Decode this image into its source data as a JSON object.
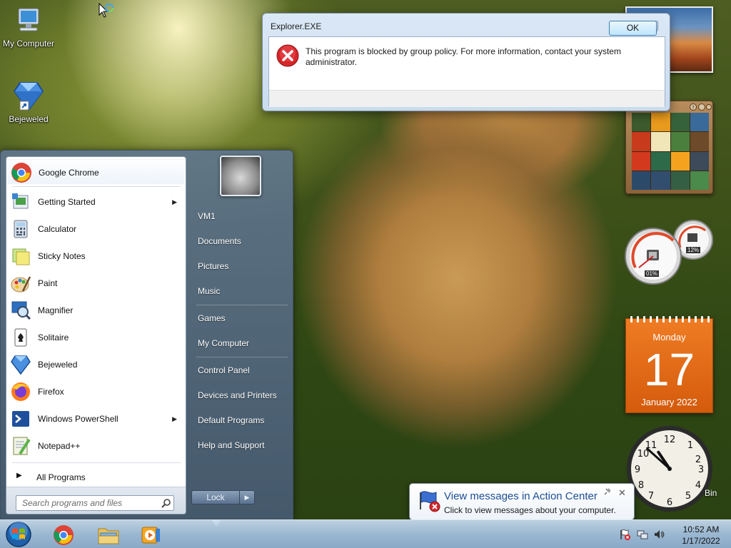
{
  "desktop": {
    "icons": [
      {
        "label": "My Computer",
        "icon": "computer-icon"
      },
      {
        "label": "Bejeweled",
        "icon": "bejeweled-icon"
      }
    ],
    "recycle_bin_partial": "Bin"
  },
  "dialog": {
    "title": "Explorer.EXE",
    "close_glyph": "✕",
    "message": "This program is blocked by group policy. For more information, contact your system administrator.",
    "ok_label": "OK",
    "icon": "error-icon"
  },
  "gadgets": {
    "meter": {
      "cpu": "01%",
      "memory": "12%"
    },
    "calendar": {
      "day_name": "Monday",
      "day": "17",
      "month_year": "January 2022"
    },
    "clock": {
      "hour": 10,
      "minute": 52
    }
  },
  "start_menu": {
    "programs": [
      {
        "label": "Google Chrome",
        "icon": "chrome-icon",
        "submenu": false
      },
      {
        "label": "Getting Started",
        "icon": "getting-started-icon",
        "submenu": true
      },
      {
        "label": "Calculator",
        "icon": "calculator-icon",
        "submenu": false
      },
      {
        "label": "Sticky Notes",
        "icon": "sticky-notes-icon",
        "submenu": false
      },
      {
        "label": "Paint",
        "icon": "paint-icon",
        "submenu": false
      },
      {
        "label": "Magnifier",
        "icon": "magnifier-icon",
        "submenu": false
      },
      {
        "label": "Solitaire",
        "icon": "solitaire-icon",
        "submenu": false
      },
      {
        "label": "Bejeweled",
        "icon": "bejeweled-icon",
        "submenu": false
      },
      {
        "label": "Firefox",
        "icon": "firefox-icon",
        "submenu": false
      },
      {
        "label": "Windows PowerShell",
        "icon": "powershell-icon",
        "submenu": true
      },
      {
        "label": "Notepad++",
        "icon": "notepadpp-icon",
        "submenu": false
      }
    ],
    "all_programs": "All Programs",
    "search_placeholder": "Search programs and files",
    "right_links": [
      {
        "label": "VM1"
      },
      {
        "label": "Documents"
      },
      {
        "label": "Pictures"
      },
      {
        "label": "Music"
      },
      {
        "label": "Games"
      },
      {
        "label": "My Computer"
      },
      {
        "label": "Control Panel"
      },
      {
        "label": "Devices and Printers"
      },
      {
        "label": "Default Programs"
      },
      {
        "label": "Help and Support"
      }
    ],
    "lock_label": "Lock",
    "lock_arrow": "▶"
  },
  "notification": {
    "title": "View messages in Action Center",
    "text": "Click to view messages about your computer.",
    "close_glyph": "✕"
  },
  "taskbar": {
    "pinned": [
      "start-orb",
      "chrome-icon",
      "explorer-icon",
      "media-player-icon"
    ],
    "tray_icons": [
      "action-center-icon",
      "network-icon",
      "volume-icon"
    ],
    "time": "10:52 AM",
    "date": "1/17/2022"
  },
  "colors": {
    "accent": "#1e4e99",
    "error": "#d6262b",
    "calendar": "#e8701a"
  }
}
